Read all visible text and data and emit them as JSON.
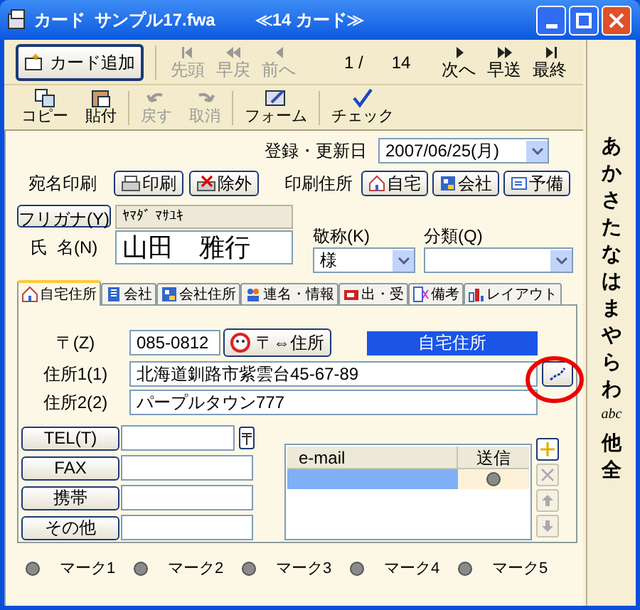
{
  "window": {
    "title": "カード  サンプル17.fwa",
    "subtitle": "≪14 カード≫"
  },
  "toolbar": {
    "add_button": "カード追加",
    "nav": [
      {
        "kind": "first",
        "label": "先頭",
        "disabled": true
      },
      {
        "kind": "rewind",
        "label": "早戻",
        "disabled": true
      },
      {
        "kind": "prev",
        "label": "前へ",
        "disabled": true
      }
    ],
    "position": "1 /",
    "total": "14",
    "nav_forward": [
      {
        "kind": "next",
        "label": "次へ",
        "disabled": false
      },
      {
        "kind": "forward",
        "label": "早送",
        "disabled": false
      },
      {
        "kind": "last",
        "label": "最終",
        "disabled": false
      }
    ]
  },
  "toolbar2": [
    {
      "kind": "copy",
      "label": "コピー",
      "disabled": false
    },
    {
      "kind": "paste",
      "label": "貼付",
      "disabled": false
    },
    {
      "kind": "undo",
      "label": "戻す",
      "disabled": true
    },
    {
      "kind": "redo",
      "label": "取消",
      "disabled": true
    },
    {
      "kind": "form",
      "label": "フォーム",
      "disabled": false
    },
    {
      "kind": "check",
      "label": "チェック",
      "disabled": false
    }
  ],
  "form": {
    "date_label": "登録・更新日",
    "date": "2007/06/25(月)",
    "print_label": "宛名印刷",
    "print_buttons": [
      {
        "kind": "print",
        "label": "印刷"
      },
      {
        "kind": "exclude",
        "label": "除外"
      }
    ],
    "print_address_label": "印刷住所",
    "address_buttons": [
      {
        "kind": "home",
        "label": "自宅"
      },
      {
        "kind": "company",
        "label": "会社"
      },
      {
        "kind": "spare",
        "label": "予備"
      }
    ],
    "furigana_button": "フリガナ(Y)",
    "furigana": "ﾔﾏﾀﾞ ﾏｻﾕｷ",
    "name_label": "氏  名(N)",
    "name": "山田　雅行",
    "honorific_label": "敬称(K)",
    "honorific": "様",
    "category_label": "分類(Q)"
  },
  "tabs": [
    {
      "kind": "home",
      "label": "自宅住所",
      "selected": true
    },
    {
      "kind": "building",
      "label": "会社",
      "selected": false
    },
    {
      "kind": "company",
      "label": "会社住所",
      "selected": false
    },
    {
      "kind": "people",
      "label": "連名・情報",
      "selected": false
    },
    {
      "kind": "mail",
      "label": "出・受",
      "selected": false
    },
    {
      "kind": "note",
      "label": "備考",
      "selected": false
    },
    {
      "kind": "layout",
      "label": "レイアウト",
      "selected": false
    }
  ],
  "address": {
    "zip_label": "〒(Z)",
    "zip": "085-0812",
    "zip_button": "〒⇔住所",
    "type_label": "自宅住所",
    "address1_label": "住所1(1)",
    "address1": "北海道釧路市紫雲台45-67-89",
    "address2_label": "住所2(2)",
    "address2": "パープルタウン777"
  },
  "phones": [
    {
      "label": "TEL(T)",
      "kind": "tel"
    },
    {
      "label": "FAX",
      "kind": "plain"
    },
    {
      "label": "携帯",
      "kind": "plain"
    },
    {
      "label": "その他",
      "kind": "plain"
    }
  ],
  "email": {
    "columns": [
      "e-mail",
      "送信"
    ],
    "rows": [
      {
        "selected": true,
        "send": false
      }
    ],
    "side_buttons": [
      {
        "kind": "add",
        "disabled": false
      },
      {
        "kind": "delete",
        "disabled": true
      },
      {
        "kind": "up",
        "disabled": true
      },
      {
        "kind": "down",
        "disabled": true
      }
    ]
  },
  "marks": [
    {
      "label": "マーク1",
      "on": false
    },
    {
      "label": "マーク2",
      "on": false
    },
    {
      "label": "マーク3",
      "on": false
    },
    {
      "label": "マーク4",
      "on": false
    },
    {
      "label": "マーク5",
      "on": false
    }
  ],
  "index": [
    "あ",
    "か",
    "さ",
    "た",
    "な",
    "は",
    "ま",
    "や",
    "ら",
    "わ",
    "abc",
    "他",
    "全"
  ]
}
